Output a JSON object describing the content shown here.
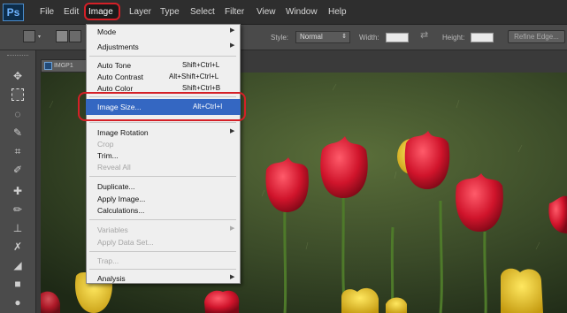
{
  "app": {
    "logo": "Ps"
  },
  "menubar": {
    "items": [
      "File",
      "Edit",
      "Image",
      "Layer",
      "Type",
      "Select",
      "Filter",
      "View",
      "Window",
      "Help"
    ]
  },
  "options_bar": {
    "style_label": "Style:",
    "style_value": "Normal",
    "width_label": "Width:",
    "height_label": "Height:",
    "refine_edge": "Refine Edge..."
  },
  "document": {
    "tab_title": "IMGP1"
  },
  "image_menu": {
    "items": [
      {
        "label": "Mode",
        "shortcut": "",
        "submenu": true,
        "disabled": false
      },
      {
        "label": "Adjustments",
        "shortcut": "",
        "submenu": true,
        "disabled": false
      },
      {
        "label": "Auto Tone",
        "shortcut": "Shift+Ctrl+L",
        "submenu": false,
        "disabled": false
      },
      {
        "label": "Auto Contrast",
        "shortcut": "Alt+Shift+Ctrl+L",
        "submenu": false,
        "disabled": false
      },
      {
        "label": "Auto Color",
        "shortcut": "Shift+Ctrl+B",
        "submenu": false,
        "disabled": false
      },
      {
        "label": "Image Size...",
        "shortcut": "Alt+Ctrl+I",
        "submenu": false,
        "disabled": false,
        "highlighted": true
      },
      {
        "label": "Image Rotation",
        "shortcut": "",
        "submenu": true,
        "disabled": false
      },
      {
        "label": "Crop",
        "shortcut": "",
        "submenu": false,
        "disabled": true
      },
      {
        "label": "Trim...",
        "shortcut": "",
        "submenu": false,
        "disabled": false
      },
      {
        "label": "Reveal All",
        "shortcut": "",
        "submenu": false,
        "disabled": true
      },
      {
        "label": "Duplicate...",
        "shortcut": "",
        "submenu": false,
        "disabled": false
      },
      {
        "label": "Apply Image...",
        "shortcut": "",
        "submenu": false,
        "disabled": false
      },
      {
        "label": "Calculations...",
        "shortcut": "",
        "submenu": false,
        "disabled": false
      },
      {
        "label": "Variables",
        "shortcut": "",
        "submenu": true,
        "disabled": true
      },
      {
        "label": "Apply Data Set...",
        "shortcut": "",
        "submenu": false,
        "disabled": true
      },
      {
        "label": "Trap...",
        "shortcut": "",
        "submenu": false,
        "disabled": true
      },
      {
        "label": "Analysis",
        "shortcut": "",
        "submenu": true,
        "disabled": false
      }
    ]
  },
  "colors": {
    "highlight_ring": "#d42027",
    "menu_highlight": "#3467c2",
    "menubar_bg": "#2e2e2e",
    "menu_bg": "#efefef"
  }
}
